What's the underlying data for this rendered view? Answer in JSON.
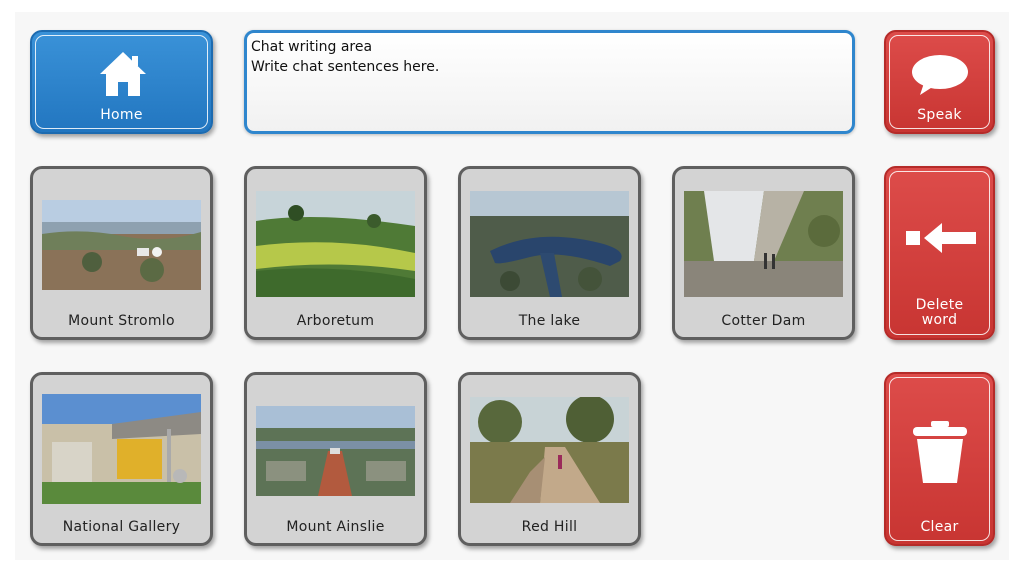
{
  "home": {
    "label": "Home"
  },
  "chat": {
    "title": "Chat writing area",
    "hint": "Write chat sentences here."
  },
  "actions": {
    "speak": "Speak",
    "delete_line1": "Delete",
    "delete_line2": "word",
    "clear": "Clear"
  },
  "places": [
    {
      "label": "Mount Stromlo"
    },
    {
      "label": "Arboretum"
    },
    {
      "label": "The lake"
    },
    {
      "label": "Cotter Dam"
    },
    {
      "label": "National Gallery"
    },
    {
      "label": "Mount Ainslie"
    },
    {
      "label": "Red Hill"
    }
  ],
  "colors": {
    "accent_blue": "#2a80c9",
    "action_red": "#d1403e",
    "tile_gray": "#d3d3d3"
  }
}
